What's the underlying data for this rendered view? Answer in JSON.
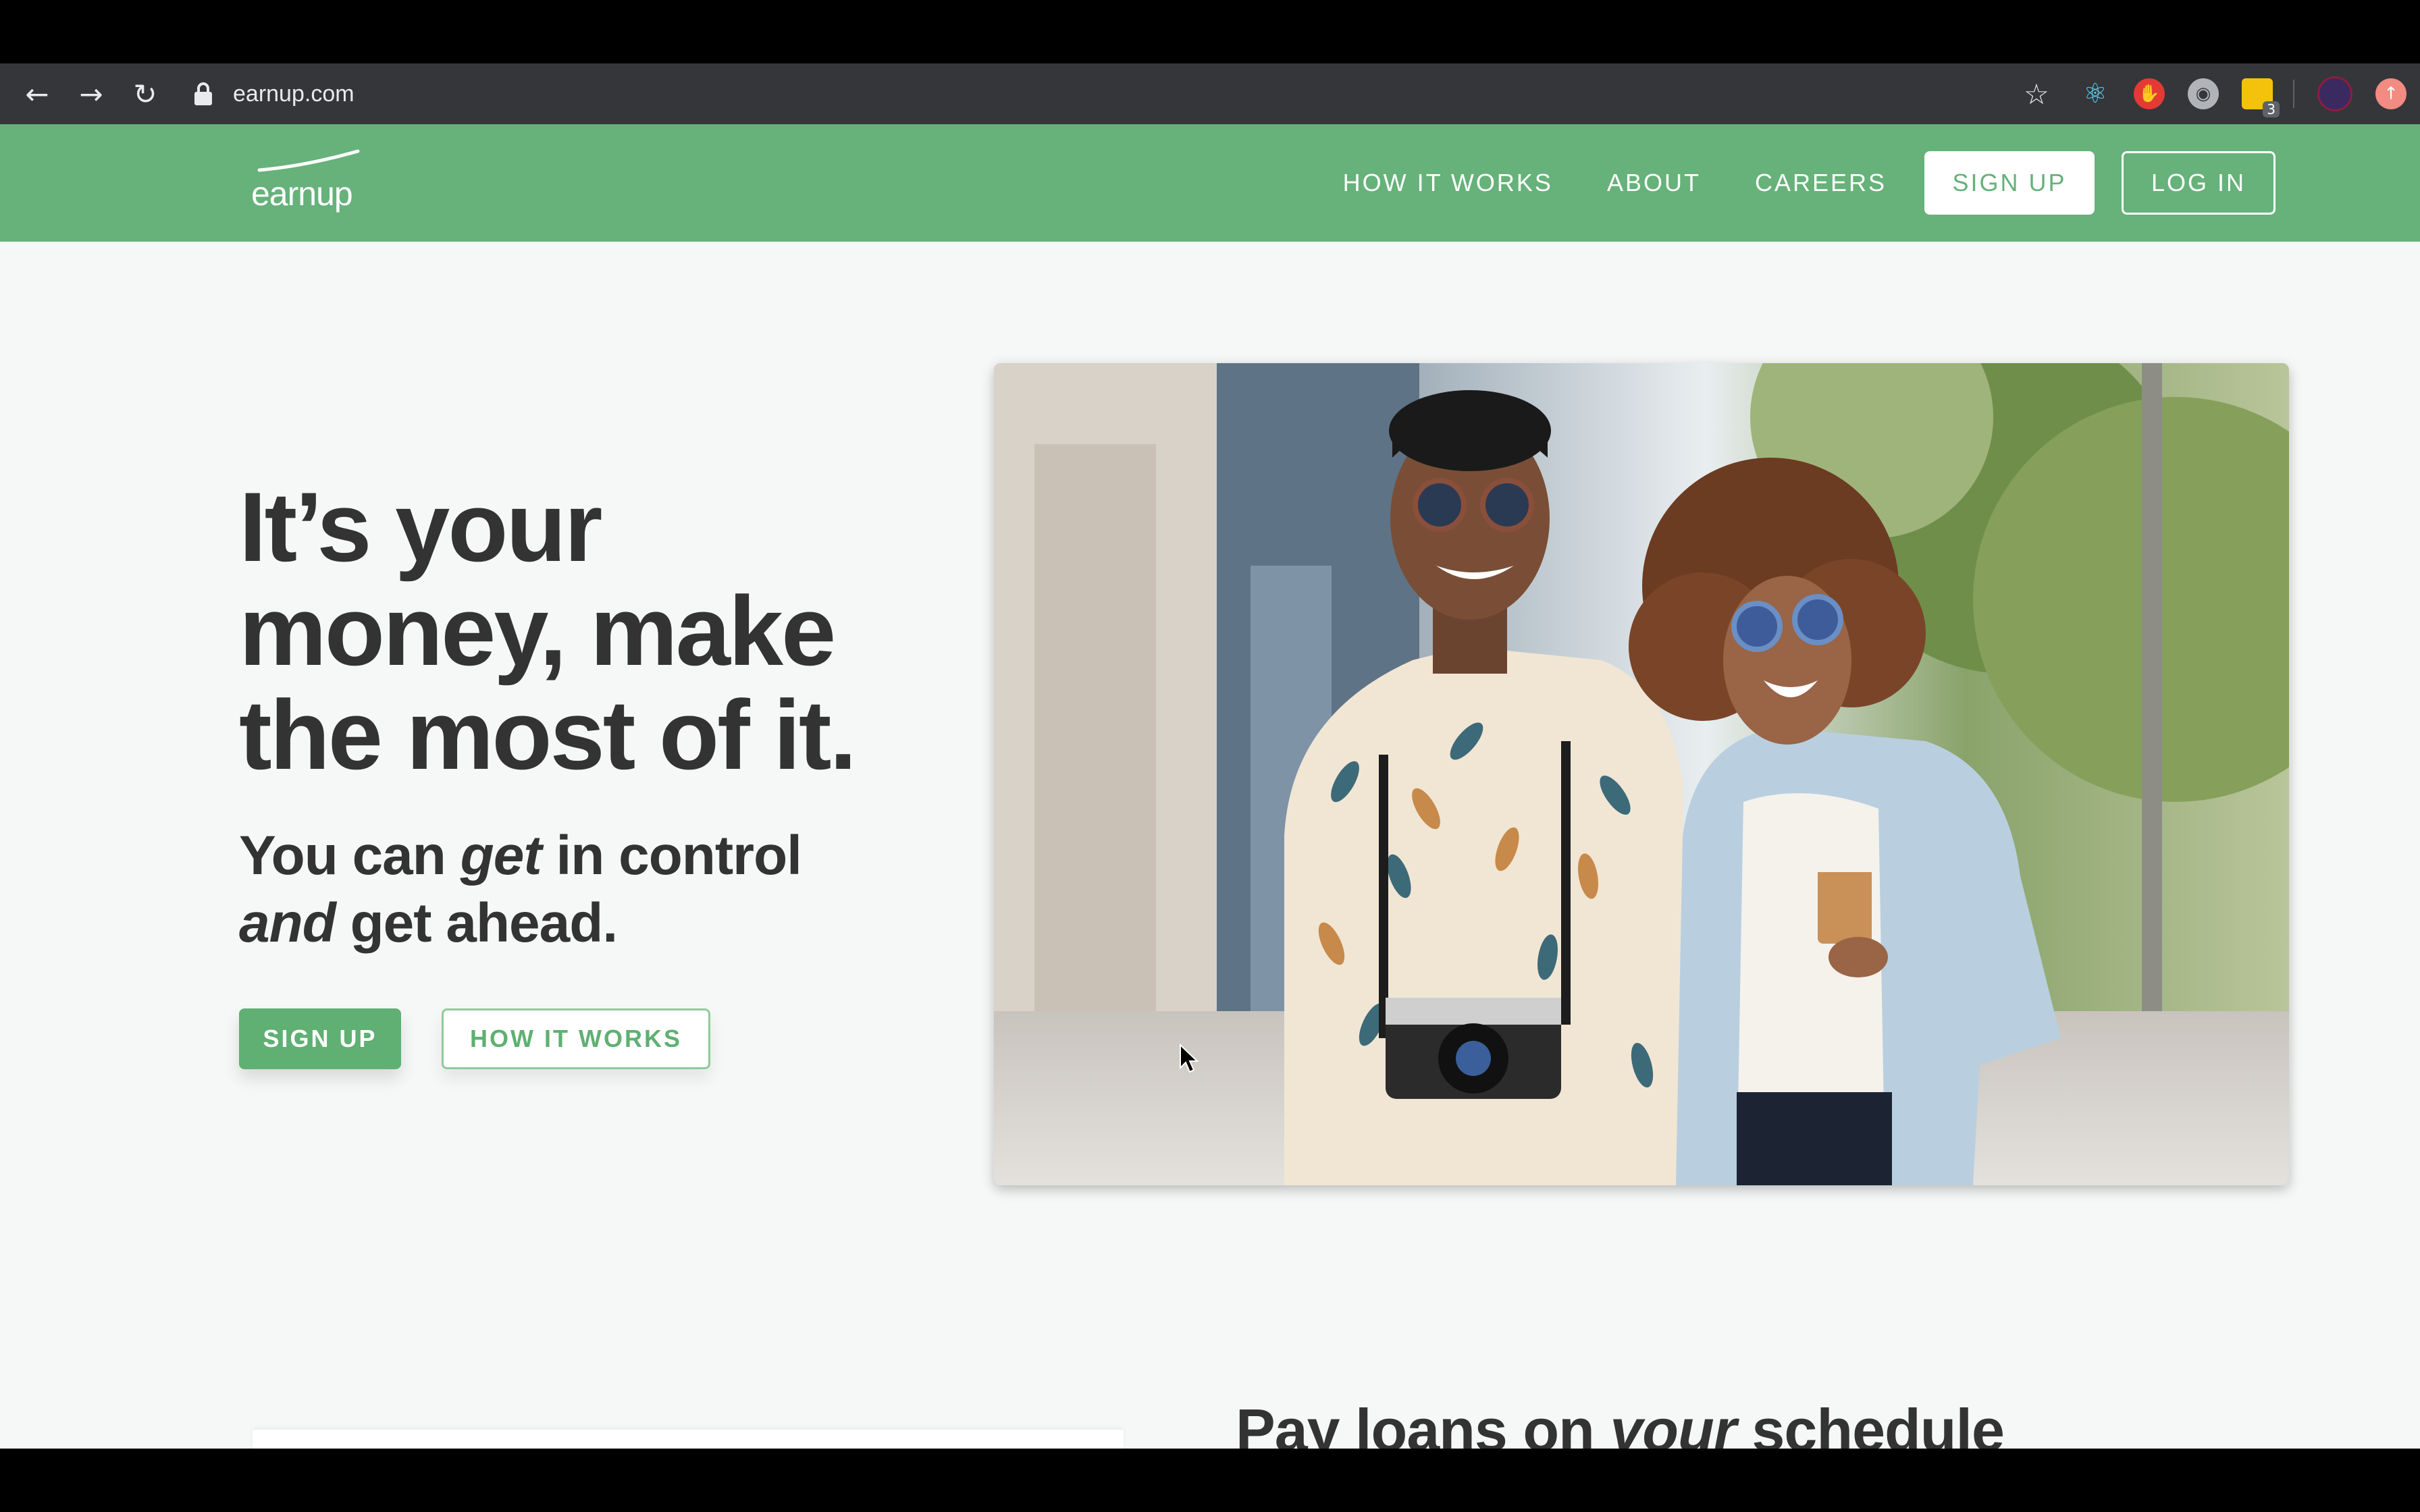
{
  "browser": {
    "url": "earnup.com",
    "extensions": [
      {
        "icon": "react-devtools-icon",
        "color": "#61dafb"
      },
      {
        "icon": "hand-stop-icon",
        "color": "#e53935"
      },
      {
        "icon": "globe-extension-icon",
        "color": "#b0b3b8"
      },
      {
        "icon": "sticky-notes-icon",
        "color": "#f4c20d",
        "badge": "3"
      },
      {
        "icon": "profile-avatar-icon",
        "color": "#3a2a60"
      },
      {
        "icon": "update-alert-icon",
        "color": "#f28b82"
      }
    ]
  },
  "site_header": {
    "logo_text": "earnup",
    "nav": {
      "how_it_works": "HOW IT WORKS",
      "about": "ABOUT",
      "careers": "CAREERS",
      "sign_up": "SIGN UP",
      "log_in": "LOG IN"
    }
  },
  "hero": {
    "title_lines": [
      "It’s your",
      "money, make",
      "the most of it."
    ],
    "subtitle": {
      "part1": "You can ",
      "em1": "get",
      "part2": " in control",
      "em2": "and",
      "part3": " get ahead."
    },
    "cta_primary": "SIGN UP",
    "cta_secondary": "HOW IT WORKS",
    "image_alt": "smiling couple walking on a city street"
  },
  "next_section": {
    "title_part1": "Pay loans on ",
    "title_em": "your",
    "title_part2": " schedule"
  },
  "colors": {
    "brand_green": "#66b27a",
    "text_dark": "#333333",
    "chrome_bg": "#35363a"
  }
}
